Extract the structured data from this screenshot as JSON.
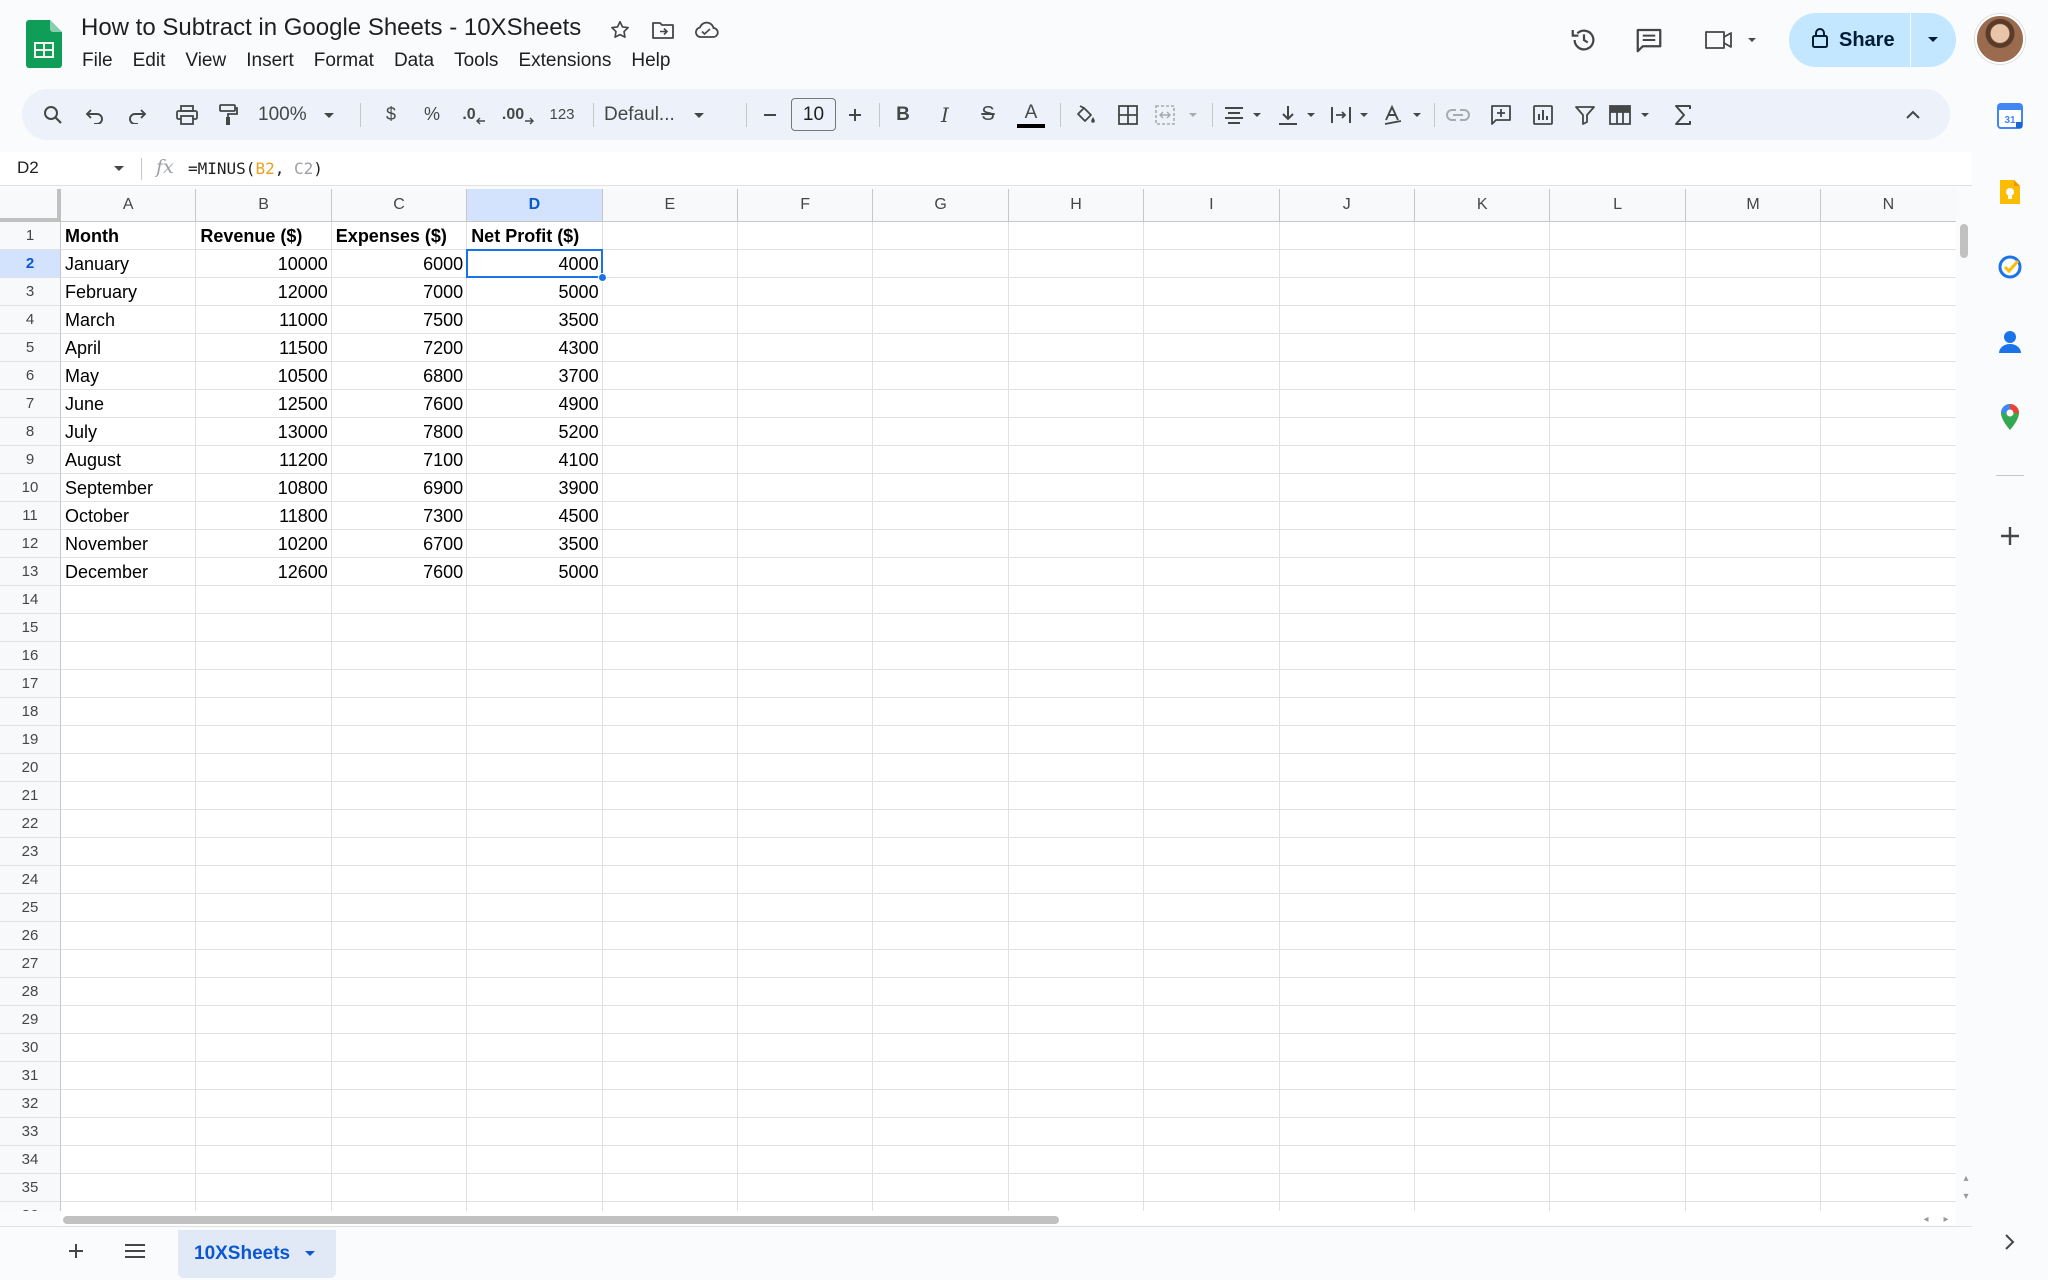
{
  "doc": {
    "title": "How to Subtract in Google Sheets - 10XSheets",
    "icons": [
      "star-icon",
      "move-to-folder-icon",
      "cloud-saved-icon"
    ]
  },
  "menu": [
    "File",
    "Edit",
    "View",
    "Insert",
    "Format",
    "Data",
    "Tools",
    "Extensions",
    "Help"
  ],
  "header_right": {
    "icons": [
      "version-history-icon",
      "comments-icon",
      "meet-icon"
    ],
    "share_label": "Share"
  },
  "toolbar": {
    "zoom": "100%",
    "currency": "$",
    "percent": "%",
    "decrease_decimal": ".0",
    "increase_decimal": ".00",
    "number_format": "123",
    "font": "Defaul...",
    "font_size": "10",
    "bold": "B",
    "italic": "I",
    "strikethrough": "S",
    "text_color": "A",
    "text_color_value": "#000000"
  },
  "formula_bar": {
    "name_box": "D2",
    "fx": "fx",
    "formula_prefix": "=MINUS(",
    "formula_ref1": "B2",
    "formula_sep": ", ",
    "formula_ref2": "C2",
    "formula_suffix": ")"
  },
  "grid": {
    "columns": [
      "A",
      "B",
      "C",
      "D",
      "E",
      "F",
      "G",
      "H",
      "I",
      "J",
      "K",
      "L",
      "M",
      "N"
    ],
    "selected_column": "D",
    "selected_row": 2,
    "row_count_visible": 35,
    "headers": [
      "Month",
      "Revenue ($)",
      "Expenses ($)",
      "Net Profit ($)"
    ],
    "rows": [
      [
        "January",
        "10000",
        "6000",
        "4000"
      ],
      [
        "February",
        "12000",
        "7000",
        "5000"
      ],
      [
        "March",
        "11000",
        "7500",
        "3500"
      ],
      [
        "April",
        "11500",
        "7200",
        "4300"
      ],
      [
        "May",
        "10500",
        "6800",
        "3700"
      ],
      [
        "June",
        "12500",
        "7600",
        "4900"
      ],
      [
        "July",
        "13000",
        "7800",
        "5200"
      ],
      [
        "August",
        "11200",
        "7100",
        "4100"
      ],
      [
        "September",
        "10800",
        "6900",
        "3900"
      ],
      [
        "October",
        "11800",
        "7300",
        "4500"
      ],
      [
        "November",
        "10200",
        "6700",
        "3500"
      ],
      [
        "December",
        "12600",
        "7600",
        "5000"
      ]
    ]
  },
  "sheet_tabs": {
    "active": "10XSheets",
    "icons": [
      "add-sheet-icon",
      "all-sheets-icon"
    ]
  },
  "side_panel": {
    "icons": [
      "calendar-icon",
      "keep-icon",
      "tasks-icon",
      "contacts-icon",
      "maps-icon",
      "get-addons-icon"
    ],
    "colors": {
      "calendar": "#4285f4",
      "keep": "#fbbc04",
      "tasks": "#1a73e8",
      "contacts": "#1a73e8",
      "maps": "#34a853"
    }
  },
  "colors": {
    "accent": "#0b57d0",
    "selection": "#1a73e8",
    "share_bg": "#c2e7ff",
    "sheets_green": "#0f9d58"
  }
}
